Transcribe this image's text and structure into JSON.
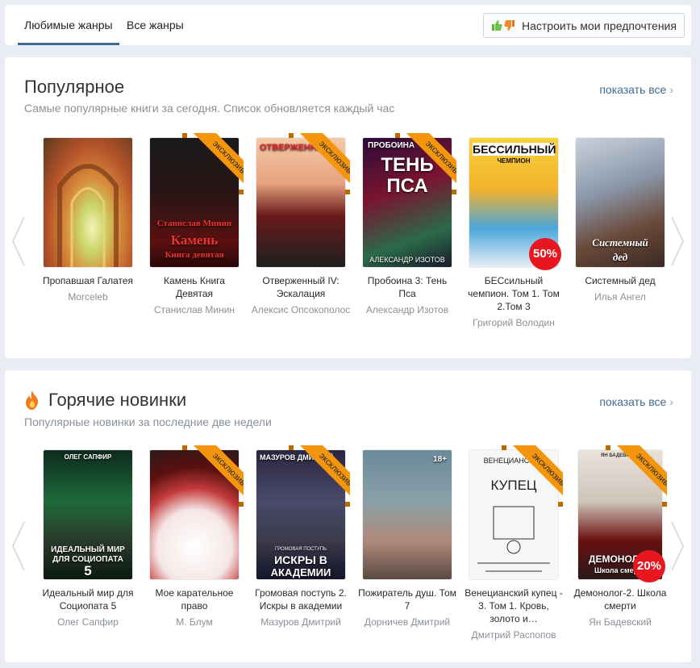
{
  "tabs": [
    {
      "label": "Любимые жанры",
      "active": true
    },
    {
      "label": "Все жанры",
      "active": false
    }
  ],
  "preferences_button": {
    "label": "Настроить мои предпочтения"
  },
  "ribbon_text": "эксклюзив",
  "show_all_label": "показать все",
  "colors": {
    "accent": "#3f6a92",
    "ribbon": "#f3950d",
    "discount": "#e8161e",
    "subtext": "#8a9097"
  },
  "sections": [
    {
      "title": "Популярное",
      "subtitle": "Самые популярные книги за сегодня. Список обновляется каждый час",
      "books": [
        {
          "title": "Пропавшая Галатея",
          "author": "Morceleb",
          "exclusive": false
        },
        {
          "title": "Камень Книга Девятая",
          "author": "Станислав Минин",
          "exclusive": true,
          "cover_lines": [
            "Станислав Минин",
            "Камень",
            "Книга девятая"
          ]
        },
        {
          "title": "Отверженный IV: Эскалация",
          "author": "Алексис Опсокополос",
          "exclusive": true,
          "cover_lines": [
            "ОТВЕРЖЕННЫЙ"
          ]
        },
        {
          "title": "Пробоина 3: Тень Пса",
          "author": "Александр Изотов",
          "exclusive": true,
          "cover_lines": [
            "ПРОБОИНА",
            "ТЕНЬ",
            "ПСА",
            "АЛЕКСАНДР ИЗОТОВ"
          ]
        },
        {
          "title": "БЕСсильный чемпион. Том 1. Том 2.Том 3",
          "author": "Григорий Володин",
          "exclusive": false,
          "discount": "50%",
          "cover_lines": [
            "БЕССИЛЬНЫЙ",
            "ЧЕМПИОН"
          ]
        },
        {
          "title": "Системный дед",
          "author": "Илья Ангел",
          "exclusive": false,
          "cover_lines": [
            "Системный",
            "дед"
          ]
        }
      ]
    },
    {
      "title": "Горячие новинки",
      "subtitle": "Популярные новинки за последние две недели",
      "icon": "fire-icon",
      "books": [
        {
          "title": "Идеальный мир для Социопата 5",
          "author": "Олег Сапфир",
          "exclusive": false,
          "cover_lines": [
            "ОЛЕГ САПФИР",
            "ИДЕАЛЬНЫЙ МИР",
            "ДЛЯ СОЦИОПАТА",
            "5"
          ]
        },
        {
          "title": "Мое карательное право",
          "author": "М. Блум",
          "exclusive": true
        },
        {
          "title": "Громовая поступь 2. Искры в академии",
          "author": "Мазуров Дмитрий",
          "exclusive": true,
          "cover_lines": [
            "МАЗУРОВ ДМИТРИЙ",
            "ГРОМОВАЯ ПОСТУПЬ",
            "ИСКРЫ В",
            "АКАДЕМИИ"
          ]
        },
        {
          "title": "Пожиратель душ. Том 7",
          "author": "Дорничев Дмитрий",
          "exclusive": false,
          "age": "18+"
        },
        {
          "title": "Венецианский купец - 3. Том 1. Кровь, золото и…",
          "author": "Дмитрий Распопов",
          "exclusive": true,
          "cover_lines": [
            "ВЕНЕЦИАНСКИЙ",
            "КУПЕЦ"
          ]
        },
        {
          "title": "Демонолог-2. Школа смерти",
          "author": "Ян Бадевский",
          "exclusive": true,
          "discount": "20%",
          "cover_lines": [
            "ЯН БАДЕВСКИЙ",
            "ДЕМОНОЛОГ",
            "Школа смерти"
          ]
        }
      ]
    }
  ]
}
